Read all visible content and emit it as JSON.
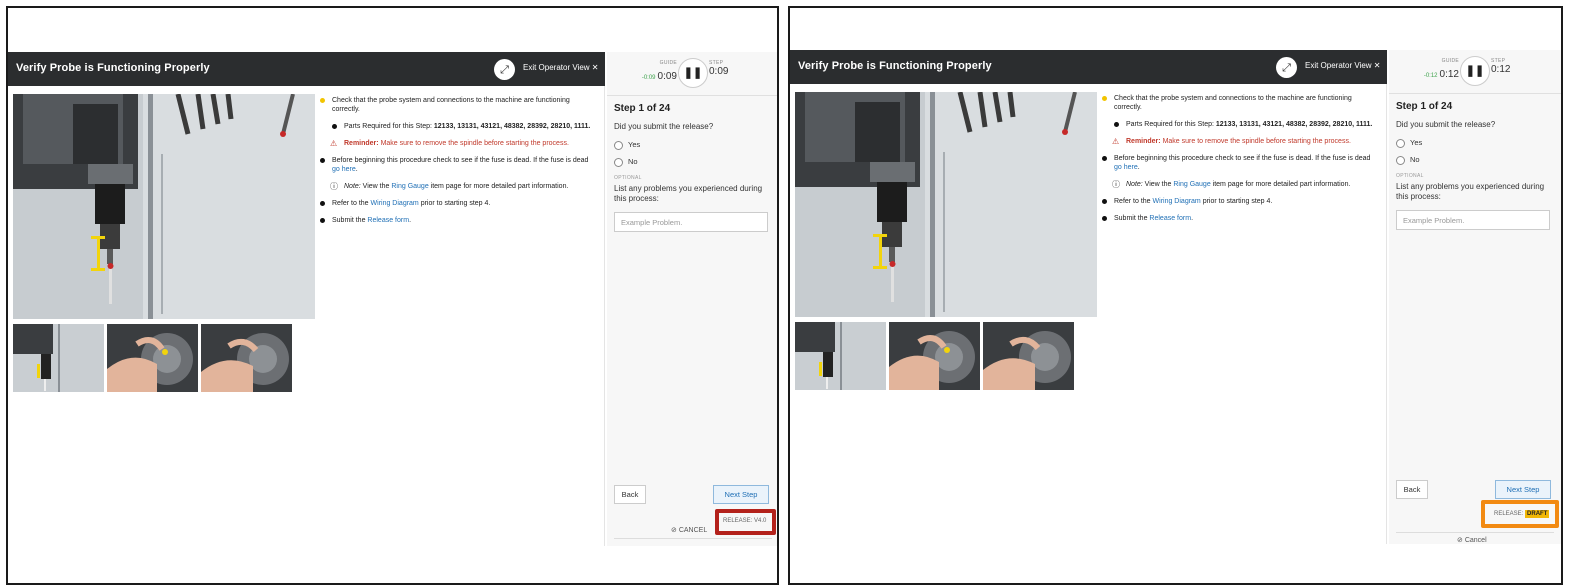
{
  "views": [
    {
      "header": {
        "title": "Verify Probe is Functioning Properly",
        "exit_label": "Exit Operator View",
        "exit_icon": "close-icon",
        "expand_icon": "expand-icon"
      },
      "timers": {
        "guide_label": "GUIDE",
        "guide_delta": "-0:09",
        "guide_time": "0:09",
        "step_label": "STEP",
        "step_time": "0:09"
      },
      "step": {
        "count": "Step 1 of 24",
        "question": "Did you submit the release?",
        "options": [
          "Yes",
          "No"
        ],
        "optional_label": "OPTIONAL",
        "list_question": "List any problems you experienced during this process:",
        "input_placeholder": "Example Problem."
      },
      "instructions": {
        "b1": "Check that the probe system and connections to the machine are functioning correctly.",
        "parts_prefix": "Parts Required for this Step: ",
        "parts": "12133, 13131, 43121, 48382, 28392, 28210, 1111.",
        "reminder_label": "Reminder:",
        "reminder_text": " Make sure to remove the spindle before starting the process.",
        "b2_text": "Before beginning this procedure check to see if the fuse is dead. If the fuse is dead ",
        "b2_link": "go here",
        "b2_end": ".",
        "note_label": "Note:",
        "note_pre": " View the ",
        "note_link": "Ring Gauge",
        "note_post": " item page for more detailed part information.",
        "b3_pre": "Refer to the ",
        "b3_link": "Wiring Diagram",
        "b3_post": " prior to starting step 4.",
        "b4_pre": "Submit the ",
        "b4_link": "Release form",
        "b4_post": "."
      },
      "footer": {
        "back": "Back",
        "next": "Next Step",
        "release_label": "RELEASE: V4.0",
        "cancel": "CANCEL"
      }
    },
    {
      "header": {
        "title": "Verify Probe is Functioning Properly",
        "exit_label": "Exit Operator View",
        "exit_icon": "close-icon",
        "expand_icon": "expand-icon"
      },
      "timers": {
        "guide_label": "GUIDE",
        "guide_delta": "-0:12",
        "guide_time": "0:12",
        "step_label": "STEP",
        "step_time": "0:12"
      },
      "step": {
        "count": "Step 1 of 24",
        "question": "Did you submit the release?",
        "options": [
          "Yes",
          "No"
        ],
        "optional_label": "OPTIONAL",
        "list_question": "List any problems you experienced during this process:",
        "input_placeholder": "Example Problem."
      },
      "instructions": {
        "b1": "Check that the probe system and connections to the machine are functioning correctly.",
        "parts_prefix": "Parts Required for this Step: ",
        "parts": "12133, 13131, 43121, 48382, 28392, 28210, 1111.",
        "reminder_label": "Reminder:",
        "reminder_text": " Make sure to remove the spindle before starting the process.",
        "b2_text": "Before beginning this procedure check to see if the fuse is dead. If the fuse is dead ",
        "b2_link": "go here",
        "b2_end": ".",
        "note_label": "Note:",
        "note_pre": " View the ",
        "note_link": "Ring Gauge",
        "note_post": " item page for more detailed part information.",
        "b3_pre": "Refer to the ",
        "b3_link": "Wiring Diagram",
        "b3_post": " prior to starting step 4.",
        "b4_pre": "Submit the ",
        "b4_link": "Release form",
        "b4_post": "."
      },
      "footer": {
        "back": "Back",
        "next": "Next Step",
        "release_prefix": "RELEASE:",
        "release_badge": "DRAFT",
        "cancel": "Cancel"
      }
    }
  ],
  "colors": {
    "header_bg": "#2b2d2f",
    "link": "#1f6fb5",
    "warning": "#c0392b",
    "highlight_red": "#b3211b",
    "highlight_orange": "#f28a12",
    "draft_badge": "#f2b705",
    "timer_delta": "#3fa34d"
  }
}
